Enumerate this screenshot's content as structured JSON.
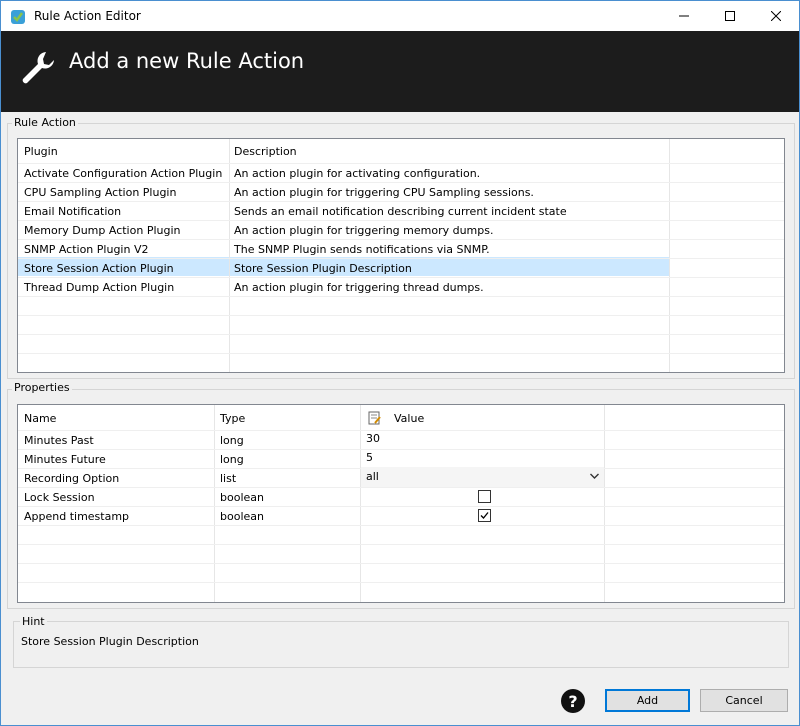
{
  "window": {
    "title": "Rule Action Editor",
    "banner_title": "Add a new Rule Action"
  },
  "rule_action": {
    "group_label": "Rule Action",
    "columns": [
      "Plugin",
      "Description"
    ],
    "rows": [
      {
        "plugin": "Activate Configuration Action Plugin",
        "description": "An action plugin for activating configuration."
      },
      {
        "plugin": "CPU Sampling Action Plugin",
        "description": "An action plugin for triggering CPU Sampling sessions."
      },
      {
        "plugin": "Email Notification",
        "description": "Sends an email notification describing current incident state"
      },
      {
        "plugin": "Memory Dump Action Plugin",
        "description": "An action plugin for triggering memory dumps."
      },
      {
        "plugin": "SNMP Action Plugin V2",
        "description": "The SNMP Plugin sends notifications via SNMP."
      },
      {
        "plugin": "Store Session Action Plugin",
        "description": "Store Session Plugin Description"
      },
      {
        "plugin": "Thread Dump Action Plugin",
        "description": "An action plugin for triggering thread dumps."
      }
    ],
    "selected_index": 5
  },
  "properties": {
    "group_label": "Properties",
    "columns": [
      "Name",
      "Type",
      "Value"
    ],
    "rows": [
      {
        "name": "Minutes Past",
        "type": "long",
        "value": "30"
      },
      {
        "name": "Minutes Future",
        "type": "long",
        "value": "5"
      },
      {
        "name": "Recording Option",
        "type": "list",
        "value": "all"
      },
      {
        "name": "Lock Session",
        "type": "boolean",
        "value": "",
        "checked": false
      },
      {
        "name": "Append timestamp",
        "type": "boolean",
        "value": "",
        "checked": true
      }
    ]
  },
  "hint": {
    "label": "Hint",
    "text": "Store Session Plugin Description"
  },
  "buttons": {
    "add": "Add",
    "cancel": "Cancel",
    "help": "?"
  },
  "colors": {
    "banner_bg": "#1c1c1c",
    "selection": "#cce8ff",
    "accent": "#0078d7"
  }
}
